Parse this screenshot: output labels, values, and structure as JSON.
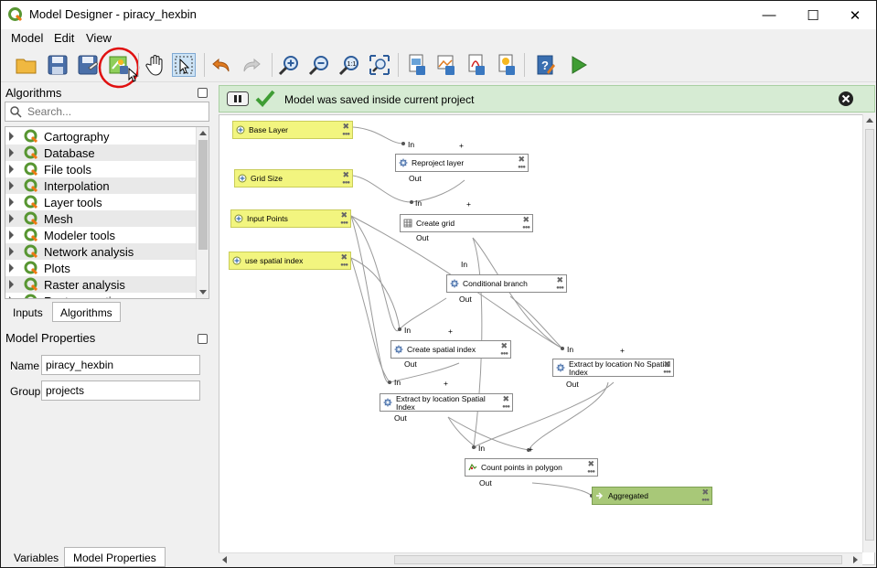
{
  "window": {
    "title": "Model Designer - piracy_hexbin",
    "minimize": "—",
    "maximize": "☐",
    "close": "✕"
  },
  "menu": {
    "model": "Model",
    "edit": "Edit",
    "view": "View"
  },
  "algorithms_panel": {
    "title": "Algorithms",
    "search_placeholder": "Search...",
    "items": [
      {
        "label": "Cartography"
      },
      {
        "label": "Database"
      },
      {
        "label": "File tools"
      },
      {
        "label": "Interpolation"
      },
      {
        "label": "Layer tools"
      },
      {
        "label": "Mesh"
      },
      {
        "label": "Modeler tools"
      },
      {
        "label": "Network analysis"
      },
      {
        "label": "Plots"
      },
      {
        "label": "Raster analysis"
      },
      {
        "label": "Raster creation"
      }
    ]
  },
  "tabs": {
    "inputs": "Inputs",
    "algorithms": "Algorithms"
  },
  "model_properties": {
    "title": "Model Properties",
    "name_label": "Name",
    "name_value": "piracy_hexbin",
    "group_label": "Group",
    "group_value": "projects"
  },
  "bottom_tabs": {
    "variables": "Variables",
    "model_properties": "Model Properties"
  },
  "message": {
    "text": "Model was saved inside current project"
  },
  "colors": {
    "input_node": "#f2f57f",
    "output_node": "#a8c878",
    "message_bg": "#d6ebd3",
    "highlight_circle": "#e01010"
  },
  "model": {
    "nodes": [
      {
        "id": "base_layer",
        "label": "Base Layer",
        "kind": "input"
      },
      {
        "id": "grid_size",
        "label": "Grid Size",
        "kind": "input"
      },
      {
        "id": "input_points",
        "label": "Input Points",
        "kind": "input"
      },
      {
        "id": "use_spatial_index",
        "label": "use spatial index",
        "kind": "input"
      },
      {
        "id": "reproject",
        "label": "Reproject layer",
        "kind": "algorithm"
      },
      {
        "id": "create_grid",
        "label": "Create grid",
        "kind": "algorithm"
      },
      {
        "id": "cond_branch",
        "label": "Conditional branch",
        "kind": "algorithm"
      },
      {
        "id": "spatial_index",
        "label": "Create spatial index",
        "kind": "algorithm"
      },
      {
        "id": "extract_no_index",
        "label": "Extract by location No Spatial Index",
        "kind": "algorithm"
      },
      {
        "id": "extract_index",
        "label": "Extract by location Spatial Index",
        "kind": "algorithm"
      },
      {
        "id": "count_points",
        "label": "Count points in polygon",
        "kind": "algorithm"
      },
      {
        "id": "aggregated",
        "label": "Aggregated",
        "kind": "output"
      }
    ],
    "port_in": "In",
    "port_out": "Out",
    "plus": "+"
  }
}
